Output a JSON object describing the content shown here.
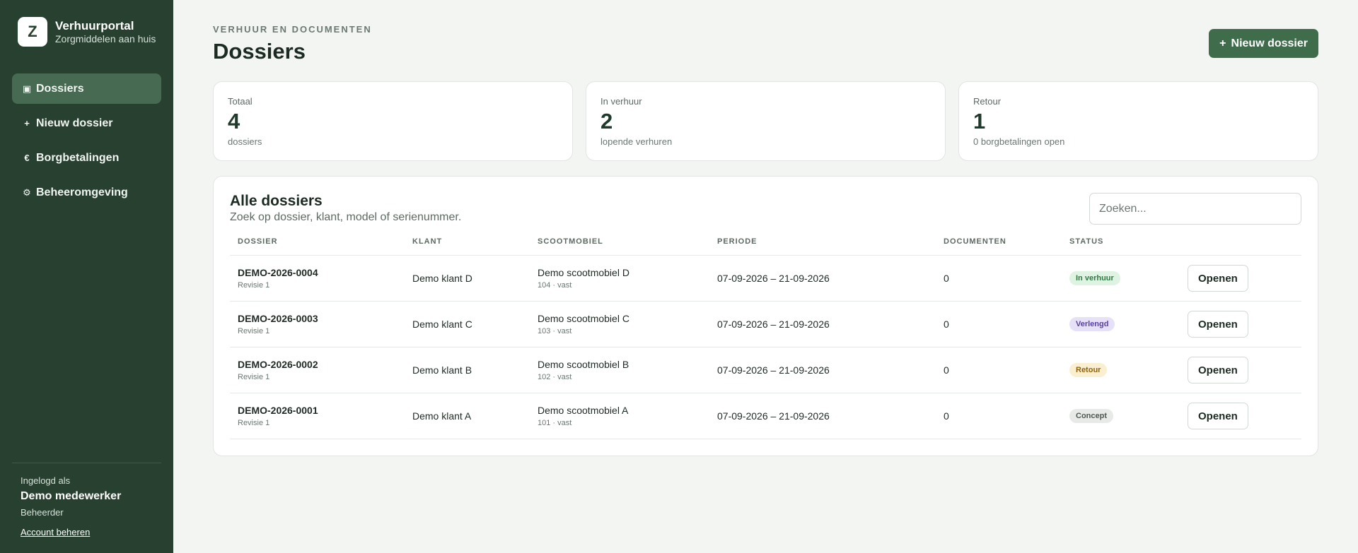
{
  "brand": {
    "logo_letter": "Z",
    "title": "Verhuurportal",
    "subtitle": "Zorgmiddelen aan huis"
  },
  "nav": {
    "items": [
      {
        "icon": "▣",
        "icon_name": "folder-icon",
        "label": "Dossiers",
        "active": true
      },
      {
        "icon": "+",
        "icon_name": "plus-icon",
        "label": "Nieuw dossier",
        "active": false
      },
      {
        "icon": "€",
        "icon_name": "euro-icon",
        "label": "Borgbetalingen",
        "active": false
      },
      {
        "icon": "⚙",
        "icon_name": "gear-icon",
        "label": "Beheeromgeving",
        "active": false
      }
    ]
  },
  "user": {
    "label": "Ingelogd als",
    "name": "Demo medewerker",
    "role": "Beheerder",
    "account_link": "Account beheren"
  },
  "header": {
    "eyebrow": "VERHUUR EN DOCUMENTEN",
    "title": "Dossiers",
    "new_button_icon": "+",
    "new_button": "Nieuw dossier"
  },
  "stats": [
    {
      "label": "Totaal",
      "value": "4",
      "sub": "dossiers"
    },
    {
      "label": "In verhuur",
      "value": "2",
      "sub": "lopende verhuren"
    },
    {
      "label": "Retour",
      "value": "1",
      "sub": "0 borgbetalingen open"
    }
  ],
  "table": {
    "title": "Alle dossiers",
    "subtitle": "Zoek op dossier, klant, model of serienummer.",
    "search_placeholder": "Zoeken...",
    "columns": [
      "DOSSIER",
      "KLANT",
      "SCOOTMOBIEL",
      "PERIODE",
      "DOCUMENTEN",
      "STATUS",
      ""
    ],
    "open_label": "Openen",
    "rows": [
      {
        "dossier": "DEMO-2026-0004",
        "revision": "Revisie 1",
        "client": "Demo klant D",
        "scooter": "Demo scootmobiel D",
        "scooter_sub": "104 · vast",
        "period": "07-09-2026 – 21-09-2026",
        "documents": "0",
        "status": "In verhuur",
        "status_key": "rented"
      },
      {
        "dossier": "DEMO-2026-0003",
        "revision": "Revisie 1",
        "client": "Demo klant C",
        "scooter": "Demo scootmobiel C",
        "scooter_sub": "103 · vast",
        "period": "07-09-2026 – 21-09-2026",
        "documents": "0",
        "status": "Verlengd",
        "status_key": "extended"
      },
      {
        "dossier": "DEMO-2026-0002",
        "revision": "Revisie 1",
        "client": "Demo klant B",
        "scooter": "Demo scootmobiel B",
        "scooter_sub": "102 · vast",
        "period": "07-09-2026 – 21-09-2026",
        "documents": "0",
        "status": "Retour",
        "status_key": "returned"
      },
      {
        "dossier": "DEMO-2026-0001",
        "revision": "Revisie 1",
        "client": "Demo klant A",
        "scooter": "Demo scootmobiel A",
        "scooter_sub": "101 · vast",
        "period": "07-09-2026 – 21-09-2026",
        "documents": "0",
        "status": "Concept",
        "status_key": "draft"
      }
    ]
  },
  "colors": {
    "sidebar_bg": "#27402f",
    "accent": "#3f6d4c",
    "status": {
      "rented": {
        "bg": "#dff3e3",
        "fg": "#2f7a43"
      },
      "extended": {
        "bg": "#e6e1f7",
        "fg": "#5a3fa3"
      },
      "returned": {
        "bg": "#fbefd2",
        "fg": "#8a6410"
      },
      "draft": {
        "bg": "#e8eae8",
        "fg": "#4f5752"
      }
    }
  }
}
